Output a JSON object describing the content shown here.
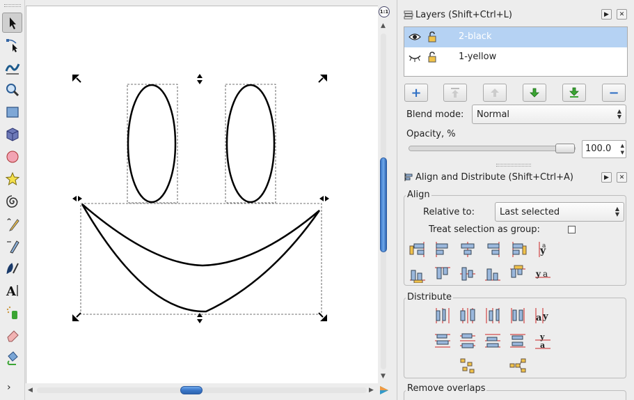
{
  "toolbox": {
    "tools": [
      "selector",
      "node",
      "tweak",
      "zoom",
      "rectangle",
      "3d-box",
      "ellipse",
      "star",
      "spiral",
      "pencil",
      "pen",
      "calligraphy",
      "text",
      "spray",
      "eraser",
      "paint-bucket"
    ],
    "more": "›"
  },
  "canvas": {
    "zoom_corner": "1:1"
  },
  "layers_panel": {
    "title": "Layers (Shift+Ctrl+L)",
    "layers": [
      {
        "name": "2-black",
        "visible": true,
        "locked": false,
        "selected": true
      },
      {
        "name": "1-yellow",
        "visible": false,
        "locked": false,
        "selected": false
      }
    ],
    "buttons": [
      "add-layer",
      "raise-to-top",
      "raise-layer",
      "lower-layer",
      "lower-to-bottom",
      "remove-layer"
    ],
    "blend_label": "Blend mode:",
    "blend_value": "Normal",
    "opacity_label": "Opacity, %",
    "opacity_value": "100.0"
  },
  "align_panel": {
    "title": "Align and Distribute (Shift+Ctrl+A)",
    "align_label": "Align",
    "relative_label": "Relative to:",
    "relative_value": "Last selected",
    "group_label": "Treat selection as group:",
    "distribute_label": "Distribute",
    "remove_overlaps_label": "Remove overlaps"
  },
  "colors": {
    "selection": "#b5d2f3",
    "scroll_thumb": "#3a76c8",
    "add_button": "#2f6fc4",
    "down_button": "#3aa533",
    "remove_button": "#2f6fc4"
  }
}
